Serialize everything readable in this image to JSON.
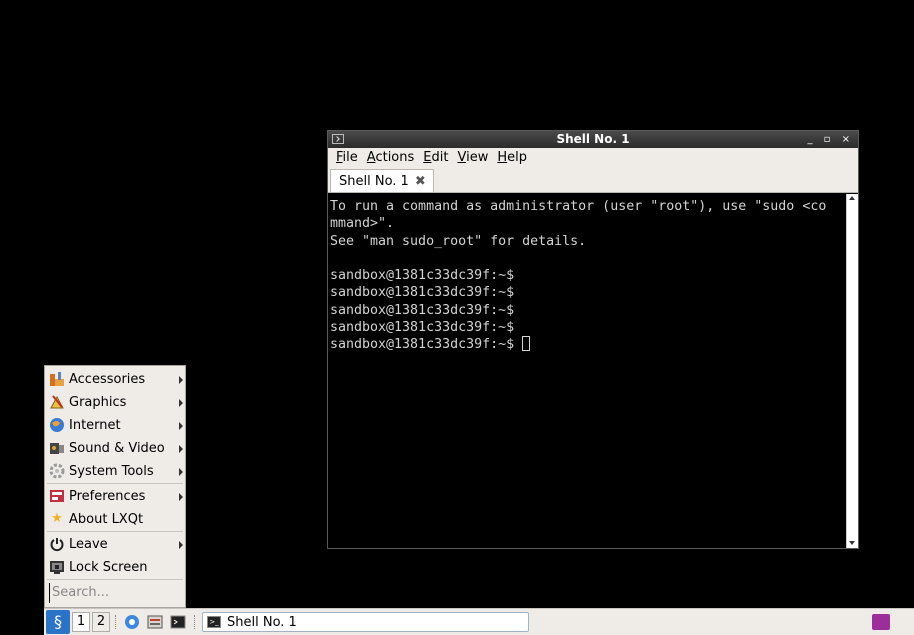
{
  "terminal": {
    "title": "Shell No. 1",
    "window_buttons": "_ ▫ ×",
    "menu": [
      {
        "label": "File",
        "mnemonic": "F"
      },
      {
        "label": "Actions",
        "mnemonic": "A"
      },
      {
        "label": "Edit",
        "mnemonic": "E"
      },
      {
        "label": "View",
        "mnemonic": "V"
      },
      {
        "label": "Help",
        "mnemonic": "H"
      }
    ],
    "tab_label": "Shell No. 1",
    "lines": [
      "To run a command as administrator (user \"root\"), use \"sudo <co",
      "mmand>\".",
      "See \"man sudo_root\" for details.",
      "",
      "sandbox@1381c33dc39f:~$",
      "sandbox@1381c33dc39f:~$",
      "sandbox@1381c33dc39f:~$",
      "sandbox@1381c33dc39f:~$",
      "sandbox@1381c33dc39f:~$ "
    ]
  },
  "start_menu": {
    "items": [
      {
        "label": "Accessories",
        "icon": "accessories-icon",
        "submenu": true
      },
      {
        "label": "Graphics",
        "icon": "graphics-icon",
        "submenu": true
      },
      {
        "label": "Internet",
        "icon": "internet-icon",
        "submenu": true
      },
      {
        "label": "Sound & Video",
        "icon": "sound-video-icon",
        "submenu": true
      },
      {
        "label": "System Tools",
        "icon": "system-tools-icon",
        "submenu": true
      },
      {
        "label": "Preferences",
        "icon": "preferences-icon",
        "submenu": true
      },
      {
        "label": "About LXQt",
        "icon": "star-icon",
        "submenu": false
      },
      {
        "label": "Leave",
        "icon": "power-icon",
        "submenu": true
      },
      {
        "label": "Lock Screen",
        "icon": "lock-screen-icon",
        "submenu": false
      }
    ],
    "search_placeholder": "Search..."
  },
  "taskbar": {
    "desktops": [
      "1",
      "2"
    ],
    "task_label": "Shell No. 1"
  },
  "colors": {
    "terminal_bg": "#000000",
    "terminal_text": "#d3d3d3",
    "panel_bg": "#efebe7",
    "start_button": "#2a73c8"
  }
}
